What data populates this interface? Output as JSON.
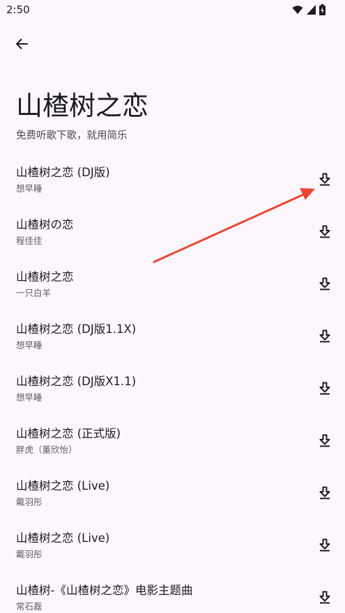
{
  "status_bar": {
    "time": "2:50",
    "icons": [
      "wifi-icon",
      "signal-icon",
      "battery-charging-icon"
    ]
  },
  "header": {
    "back_icon": "arrow-left-icon",
    "title": "山楂树之恋",
    "subtitle": "免费听歌下歌，就用简乐"
  },
  "songs": [
    {
      "title": "山楂树之恋 (DJ版)",
      "artist": "想早睡"
    },
    {
      "title": "山楂树の恋",
      "artist": "程佳佳"
    },
    {
      "title": "山楂树之恋",
      "artist": "一只白羊"
    },
    {
      "title": "山楂树之恋 (DJ版1.1X)",
      "artist": "想早睡"
    },
    {
      "title": "山楂树之恋 (DJ版X1.1)",
      "artist": "想早睡"
    },
    {
      "title": "山楂树之恋 (正式版)",
      "artist": "胖虎（董欣怡）"
    },
    {
      "title": "山楂树之恋 (Live)",
      "artist": "戴羽彤"
    },
    {
      "title": "山楂树之恋 (Live)",
      "artist": "戴羽彤"
    },
    {
      "title": "山楂树-《山楂树之恋》电影主题曲",
      "artist": "常石磊"
    }
  ],
  "colors": {
    "background": "#fdf7fd",
    "text_primary": "#1c1b1f",
    "text_secondary": "#5f5b66",
    "annotation_arrow": "#e8472f"
  }
}
